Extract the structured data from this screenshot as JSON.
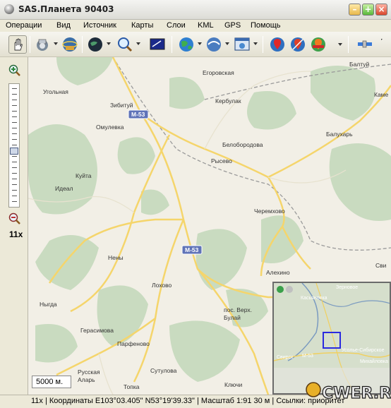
{
  "window": {
    "title": "SAS.Планета 90403"
  },
  "menu": [
    "Операции",
    "Вид",
    "Источник",
    "Карты",
    "Слои",
    "KML",
    "GPS",
    "Помощь"
  ],
  "toolbar": {
    "buttons": [
      "hand-tool",
      "satellite-source",
      "network",
      "map-globe",
      "zoom-tool",
      "map-view",
      "globe-blue",
      "globe-dark",
      "layers-window",
      "location-red",
      "location-pin",
      "location-multi",
      "satellite-gps"
    ]
  },
  "zoom": {
    "level_label": "11x"
  },
  "map": {
    "places": [
      "Балтуй",
      "Егоровская",
      "Угольная",
      "Зибитуй",
      "Кербулак",
      "Каме",
      "М-53",
      "Омулевка",
      "Балухарь",
      "Белобородова",
      "Рысево",
      "Куйта",
      "Идеал",
      "Черемхово",
      "М-53",
      "Нены",
      "Алехино",
      "Сви",
      "Лохово",
      "пос. Верх. Булай",
      "Ныгда",
      "Герасимова",
      "Парфеново",
      "Русская Аларь",
      "Сутулова",
      "Топка",
      "Ключи"
    ],
    "scale_label": "5000 м."
  },
  "minimap": {
    "labels": [
      "Зерновое",
      "Касьяновка",
      "Усолье-Сибирское",
      "Михайловка",
      "Свирск",
      "М-53"
    ]
  },
  "status": {
    "text": "11x | Координаты E103°03.405\" N53°19'39.33\" | Масштаб 1:91 30 м | Ссылки: приоритет"
  },
  "watermark": {
    "text": "CWER.RU"
  },
  "colors": {
    "background": "#f2efe6",
    "forest": "#c9dbc0",
    "road": "#f5d56b",
    "highway_shield": "#5f73b8"
  }
}
